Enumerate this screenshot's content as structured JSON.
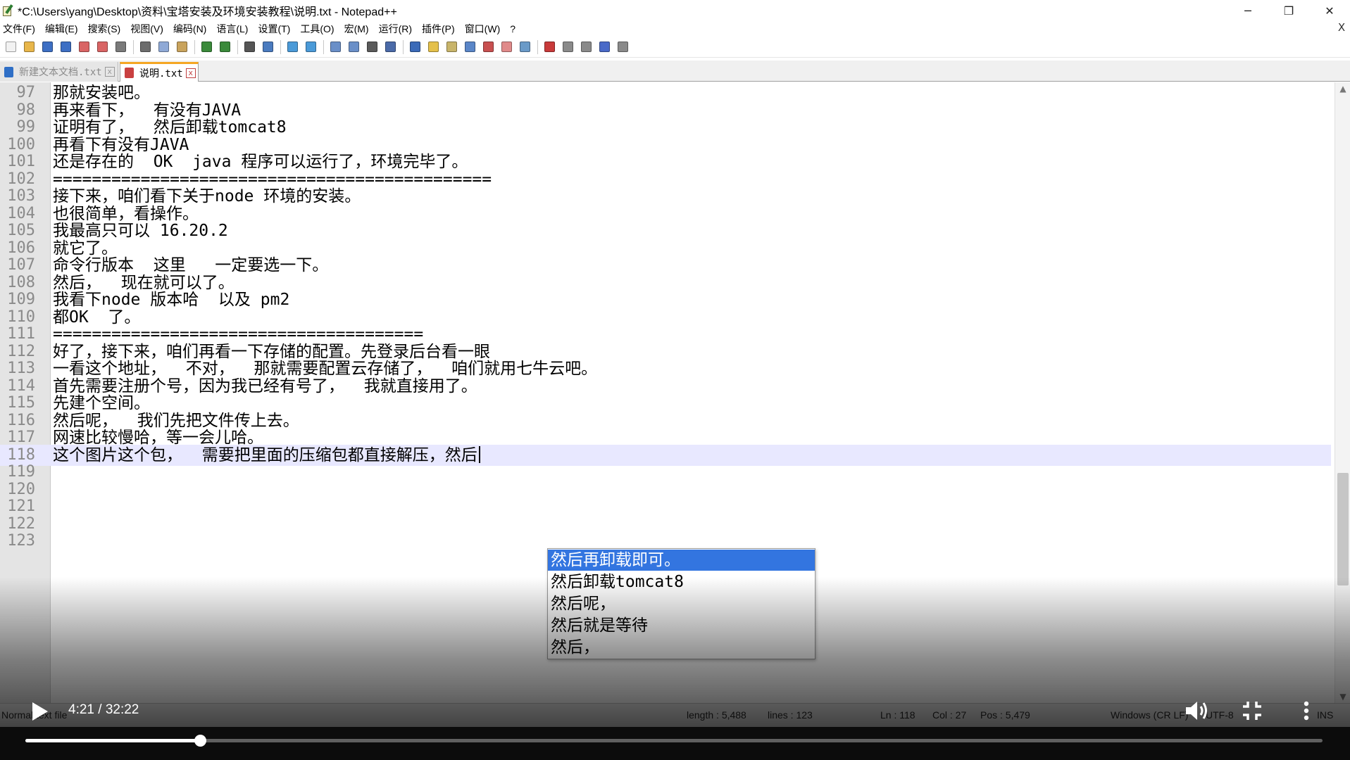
{
  "window": {
    "title": "*C:\\Users\\yang\\Desktop\\资料\\宝塔安装及环境安装教程\\说明.txt - Notepad++",
    "minimize": "─",
    "restore": "❐",
    "close": "✕",
    "doc_close": "X"
  },
  "menu": [
    "文件(F)",
    "编辑(E)",
    "搜索(S)",
    "视图(V)",
    "编码(N)",
    "语言(L)",
    "设置(T)",
    "工具(O)",
    "宏(M)",
    "运行(R)",
    "插件(P)",
    "窗口(W)",
    "?"
  ],
  "toolbar": {
    "groups": [
      [
        "new-file-icon",
        "open-file-icon",
        "save-icon",
        "save-all-icon",
        "close-icon",
        "close-all-icon",
        "print-icon"
      ],
      [
        "cut-icon",
        "copy-icon",
        "paste-icon"
      ],
      [
        "undo-icon",
        "redo-icon"
      ],
      [
        "find-icon",
        "replace-icon"
      ],
      [
        "zoom-in-icon",
        "zoom-out-icon"
      ],
      [
        "sync-vertical-icon",
        "sync-horizontal-icon",
        "word-wrap-icon",
        "show-all-chars-icon"
      ],
      [
        "indent-guide-icon",
        "udl-icon",
        "doc-map-icon",
        "doc-list-icon",
        "function-list-icon",
        "folder-workspace-icon",
        "monitoring-icon"
      ],
      [
        "record-macro-icon",
        "stop-record-icon",
        "play-macro-icon",
        "run-macro-multiple-icon",
        "save-macro-icon"
      ]
    ],
    "colors": {
      "new-file-icon": "#f2f2f2",
      "open-file-icon": "#e8b64a",
      "save-icon": "#3d6fc4",
      "save-all-icon": "#3d6fc4",
      "close-icon": "#d96464",
      "close-all-icon": "#d96464",
      "print-icon": "#7a7a7a",
      "cut-icon": "#6d6d6d",
      "copy-icon": "#8fa9d6",
      "paste-icon": "#c9a35c",
      "undo-icon": "#3a8a3a",
      "redo-icon": "#3a8a3a",
      "find-icon": "#555555",
      "replace-icon": "#4a7bbf",
      "zoom-in-icon": "#4a9ad8",
      "zoom-out-icon": "#4a9ad8",
      "sync-vertical-icon": "#6a8fc8",
      "sync-horizontal-icon": "#6a8fc8",
      "word-wrap-icon": "#5a5a5a",
      "show-all-chars-icon": "#4a6aa8",
      "indent-guide-icon": "#3a6ab8",
      "udl-icon": "#e4c04a",
      "doc-map-icon": "#c8b46a",
      "doc-list-icon": "#5a86c8",
      "function-list-icon": "#c85050",
      "folder-workspace-icon": "#e08a8a",
      "monitoring-icon": "#6a9ac8",
      "record-macro-icon": "#c83a3a",
      "stop-record-icon": "#8a8a8a",
      "play-macro-icon": "#8a8a8a",
      "run-macro-multiple-icon": "#4a6ac8",
      "save-macro-icon": "#8a8a8a"
    }
  },
  "tabs": [
    {
      "label": "新建文本文档.txt",
      "active": false,
      "close": "x"
    },
    {
      "label": "说明.txt",
      "active": true,
      "close": "x"
    }
  ],
  "lines": [
    {
      "n": "97",
      "text": "那就安装吧。"
    },
    {
      "n": "98",
      "text": "再来看下，  有没有JAVA"
    },
    {
      "n": "99",
      "text": "证明有了，  然后卸载tomcat8"
    },
    {
      "n": "100",
      "text": "再看下有没有JAVA"
    },
    {
      "n": "101",
      "text": "还是存在的  OK  java 程序可以运行了，环境完毕了。"
    },
    {
      "n": "102",
      "text": "============================================="
    },
    {
      "n": "103",
      "text": "接下来，咱们看下关于node 环境的安装。"
    },
    {
      "n": "104",
      "text": "也很简单，看操作。"
    },
    {
      "n": "105",
      "text": "我最高只可以 16.20.2"
    },
    {
      "n": "106",
      "text": "就它了。"
    },
    {
      "n": "107",
      "text": "命令行版本  这里   一定要选一下。"
    },
    {
      "n": "108",
      "text": "然后，  现在就可以了。"
    },
    {
      "n": "109",
      "text": "我看下node 版本哈  以及 pm2"
    },
    {
      "n": "110",
      "text": "都OK  了。"
    },
    {
      "n": "111",
      "text": "======================================"
    },
    {
      "n": "112",
      "text": "好了，接下来，咱们再看一下存储的配置。先登录后台看一眼"
    },
    {
      "n": "113",
      "text": "一看这个地址，  不对，  那就需要配置云存储了，  咱们就用七牛云吧。"
    },
    {
      "n": "114",
      "text": "首先需要注册个号，因为我已经有号了，  我就直接用了。"
    },
    {
      "n": "115",
      "text": "先建个空间。"
    },
    {
      "n": "116",
      "text": "然后呢，  我们先把文件传上去。"
    },
    {
      "n": "117",
      "text": "网速比较慢哈，等一会儿哈。"
    },
    {
      "n": "118",
      "text": "这个图片这个包，  需要把里面的压缩包都直接解压，然后",
      "current": true
    },
    {
      "n": "119",
      "text": ""
    },
    {
      "n": "120",
      "text": ""
    },
    {
      "n": "121",
      "text": ""
    },
    {
      "n": "122",
      "text": ""
    },
    {
      "n": "123",
      "text": ""
    }
  ],
  "autocomplete": [
    {
      "text": "然后再卸载即可。",
      "selected": true
    },
    {
      "text": "然后卸载tomcat8",
      "selected": false
    },
    {
      "text": "然后呢，",
      "selected": false
    },
    {
      "text": "然后就是等待",
      "selected": false
    },
    {
      "text": "然后，",
      "selected": false
    }
  ],
  "statusbar": {
    "type": "Normal text file",
    "length": "length : 5,488",
    "lines": "lines : 123",
    "ln": "Ln : 118",
    "col": "Col : 27",
    "pos": "Pos : 5,479",
    "eol": "Windows (CR LF)",
    "encoding": "UTF-8",
    "mode": "INS"
  },
  "player": {
    "time": "4:21 / 32:22",
    "progress": 0.1349,
    "icons": {
      "play": "play-icon",
      "volume": "volume-icon",
      "fullscreen": "exit-fullscreen-icon",
      "more": "more-vertical-icon"
    }
  }
}
